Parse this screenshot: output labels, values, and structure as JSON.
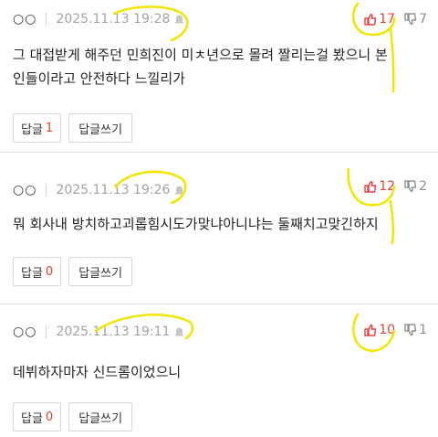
{
  "comments": [
    {
      "author": "○○",
      "date": "2025.11.13 19:28",
      "upvotes": "17",
      "downvotes": "7",
      "text_lines": [
        "그 대접받게 해주던 민희진이 미ㅊ년으로 몰려 짤리는걸 봤으니 본",
        "인들이라고 안전하다 느낄리가"
      ],
      "reply_label": "답글",
      "reply_count": "1",
      "write_reply_label": "답글쓰기"
    },
    {
      "author": "○○",
      "date": "2025.11.13 19:26",
      "upvotes": "12",
      "downvotes": "2",
      "text_lines": [
        "뭐 회사내 방치하고괴롭힘시도가맞냐아니냐는 둘째치고맞긴하지"
      ],
      "reply_label": "답글",
      "reply_count": "0",
      "write_reply_label": "답글쓰기"
    },
    {
      "author": "○○",
      "date": "2025.11.13 19:11",
      "upvotes": "10",
      "downvotes": "1",
      "text_lines": [
        "데뷔하자마자 신드롬이었으니"
      ],
      "reply_label": "답글",
      "reply_count": "0",
      "write_reply_label": "답글쓰기"
    }
  ],
  "colors": {
    "upvote": "#e64040",
    "reply_count": "#e0402e",
    "highlighter": "#f2e600"
  },
  "icons": {
    "thumbs_up": "thumbs-up-icon",
    "thumbs_down": "thumbs-down-icon",
    "notify": "bell-icon"
  }
}
